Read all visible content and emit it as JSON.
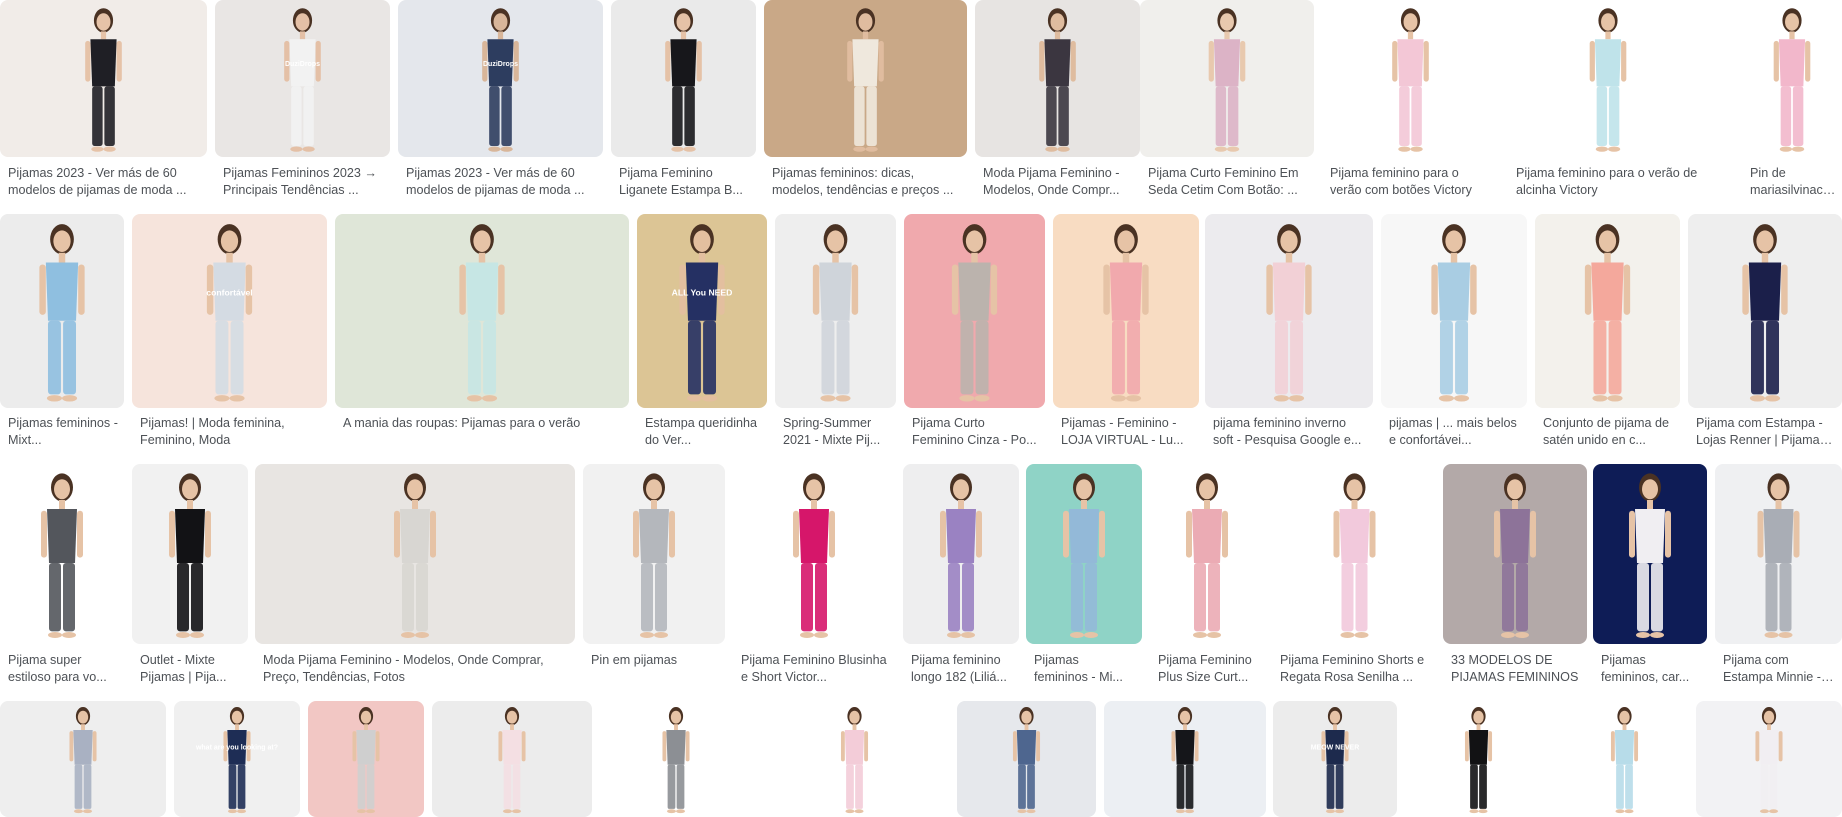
{
  "results": [
    {
      "caption": "Pijamas 2023 - Ver más de 60 modelos de pijamas de moda ...",
      "bg": "#f1ece8",
      "fig": "#1f1f25",
      "skin": "#e6c3a8"
    },
    {
      "caption": "Pijamas Femininos 2023 → Principais Tendências ...",
      "bg": "#e9e6e4",
      "fig": "#f2f2f2",
      "skin": "#e4c0a6",
      "logo": "DuziDrops"
    },
    {
      "caption": "Pijamas 2023 - Ver más de 60 modelos de pijamas de moda ...",
      "bg": "#e4e7ec",
      "fig": "#2d3d5f",
      "skin": "#d8b69a",
      "logo": "DuziDrops"
    },
    {
      "caption": "Pijama Feminino Liganete Estampa B...",
      "bg": "#eaeaea",
      "fig": "#17171b",
      "skin": "#e5c2a7"
    },
    {
      "caption": "Pijamas femininos: dicas, modelos, tendências e preços ...",
      "bg": "#c9a887",
      "fig": "#efe8dd",
      "skin": "#e0bc9f"
    },
    {
      "caption": "Moda Pijama Feminino - Modelos, Onde Compr...",
      "bg": "#e7e4e2",
      "fig": "#3b3640",
      "skin": "#dfbc9f"
    },
    {
      "caption": "Pijama Curto Feminino Em Seda Cetim Com Botão: ...",
      "bg": "#f0efec",
      "fig": "#dcb3c6",
      "skin": "#e8c9ae"
    },
    {
      "caption": "Pijama feminino para o verão com botões Victory",
      "bg": "#ffffff",
      "fig": "#f3c7d6",
      "skin": "#e6c3a6"
    },
    {
      "caption": "Pijama feminino para o verão de alcinha Victory",
      "bg": "#ffffff",
      "fig": "#bfe3ea",
      "skin": "#e6c3a6"
    },
    {
      "caption": "Pin de mariasilvinach...",
      "bg": "#ffffff",
      "fig": "#f2b7cb",
      "skin": "#e6c3a6"
    },
    {
      "caption": "Pijamas femininos - Mixt...",
      "bg": "#ececec",
      "fig": "#8fbfe0",
      "skin": "#e6c3a6"
    },
    {
      "caption": "Pijamas! | Moda feminina, Feminino, Moda",
      "bg": "#f6e4dc",
      "fig": "#d4dbe3",
      "skin": "#e6c3a6",
      "logo": "confortável"
    },
    {
      "caption": "A mania das roupas: Pijamas para o verão",
      "bg": "#dfe6d8",
      "fig": "#c6e6e4",
      "skin": "#e6c3a6"
    },
    {
      "caption": "Estampa queridinha do Ver...",
      "bg": "#dcc595",
      "fig": "#253063",
      "skin": "#e3bf9f",
      "logo": "ALL You NEED"
    },
    {
      "caption": "Spring-Summer 2021 - Mixte Pij...",
      "bg": "#eeeeee",
      "fig": "#cfd4da",
      "skin": "#e6c3a6"
    },
    {
      "caption": "Pijama Curto Feminino Cinza - Po...",
      "bg": "#f0a9ad",
      "fig": "#bbb3ad",
      "skin": "#e6c3a6"
    },
    {
      "caption": "Pijamas - Feminino - LOJA VIRTUAL - Lu...",
      "bg": "#f8dcc2",
      "fig": "#f1a9ad",
      "skin": "#e6c3a6"
    },
    {
      "caption": "pijama feminino inverno soft - Pesquisa Google e...",
      "bg": "#ecebee",
      "fig": "#f2d0d6",
      "skin": "#e6c3a6"
    },
    {
      "caption": "pijamas | ... mais belos e confortávei...",
      "bg": "#f7f7f7",
      "fig": "#a9cde3",
      "skin": "#e6c3a6"
    },
    {
      "caption": "Conjunto de pijama de satén unido en c...",
      "bg": "#f3f1ec",
      "fig": "#f4a89c",
      "skin": "#e6c3a6"
    },
    {
      "caption": "Pijama com Estampa - Lojas Renner | Pijama fe...",
      "bg": "#eeeeee",
      "fig": "#1b1f4a",
      "skin": "#e6c3a6"
    },
    {
      "caption": "Pijama super estiloso para vo...",
      "bg": "#ffffff",
      "fig": "#53565c",
      "skin": "#e6c3a6"
    },
    {
      "caption": "Outlet - Mixte Pijamas | Pija...",
      "bg": "#f1f1f1",
      "fig": "#121215",
      "skin": "#e6c3a6"
    },
    {
      "caption": "Moda Pijama Feminino - Modelos, Onde Comprar, Preço, Tendências, Fotos",
      "bg": "#e8e5e2",
      "fig": "#d8d6d2",
      "skin": "#e6c3a6"
    },
    {
      "caption": "Pin em pijamas",
      "bg": "#f1f1f1",
      "fig": "#b4b7bc",
      "skin": "#e6c3a6"
    },
    {
      "caption": "Pijama Feminino Blusinha e Short Victor...",
      "bg": "#ffffff",
      "fig": "#d6166a",
      "skin": "#e6c3a6"
    },
    {
      "caption": "Pijama feminino longo 182 (Liliá...",
      "bg": "#eeeeef",
      "fig": "#9a82c2",
      "skin": "#e6c3a6"
    },
    {
      "caption": "Pijamas femininos - Mi...",
      "bg": "#8fd3c6",
      "fig": "#93b9d8",
      "skin": "#e6c3a6"
    },
    {
      "caption": "Pijama Feminino Plus Size Curt...",
      "bg": "#ffffff",
      "fig": "#ebabb4",
      "skin": "#e6c3a6"
    },
    {
      "caption": "Pijama Feminino Shorts e Regata Rosa Senilha ...",
      "bg": "#ffffff",
      "fig": "#f2c9dc",
      "skin": "#e6c3a6"
    },
    {
      "caption": "33 MODELOS DE PIJAMAS FEMININOS",
      "bg": "#b3a9a8",
      "fig": "#8d7399",
      "skin": "#e6c3a6"
    },
    {
      "caption": "Pijamas femininos, car...",
      "bg": "#0e1c56",
      "fig": "#f0eef2",
      "skin": "#e6c3a6"
    },
    {
      "caption": "Pijama com Estampa Minnie - Lojas Renn...",
      "bg": "#eff0f2",
      "fig": "#a9adb5",
      "skin": "#e6c3a6"
    },
    {
      "caption": "",
      "bg": "#eeeeee",
      "fig": "#a9b1c2",
      "skin": "#e6c3a6"
    },
    {
      "caption": "",
      "bg": "#f0f0f0",
      "fig": "#1e2d55",
      "skin": "#e6c3a6",
      "logo": "what are you looking at?"
    },
    {
      "caption": "",
      "bg": "#f2c7c4",
      "fig": "#cfcfcf",
      "skin": "#e6c3a6"
    },
    {
      "caption": "",
      "bg": "#ececec",
      "fig": "#f4dfe3",
      "skin": "#e6c3a6"
    },
    {
      "caption": "",
      "bg": "#ffffff",
      "fig": "#8c8f94",
      "skin": "#e6c3a6"
    },
    {
      "caption": "",
      "bg": "#ffffff",
      "fig": "#f3ccd8",
      "skin": "#e6c3a6"
    },
    {
      "caption": "",
      "bg": "#e6e8ec",
      "fig": "#4e668f",
      "skin": "#e6c3a6"
    },
    {
      "caption": "",
      "bg": "#eceff3",
      "fig": "#15161a",
      "skin": "#e6c3a6"
    },
    {
      "caption": "",
      "bg": "#ececec",
      "fig": "#1d2a4d",
      "skin": "#e6c3a6",
      "logo": "MEOW NEVER"
    },
    {
      "caption": "",
      "bg": "#ffffff",
      "fig": "#121214",
      "skin": "#e6c3a6"
    },
    {
      "caption": "",
      "bg": "#ffffff",
      "fig": "#b7dce9",
      "skin": "#e6c3a6"
    },
    {
      "caption": "",
      "bg": "#f2f2f4",
      "fig": "#f1eef2",
      "skin": "#e6c3a6"
    }
  ]
}
